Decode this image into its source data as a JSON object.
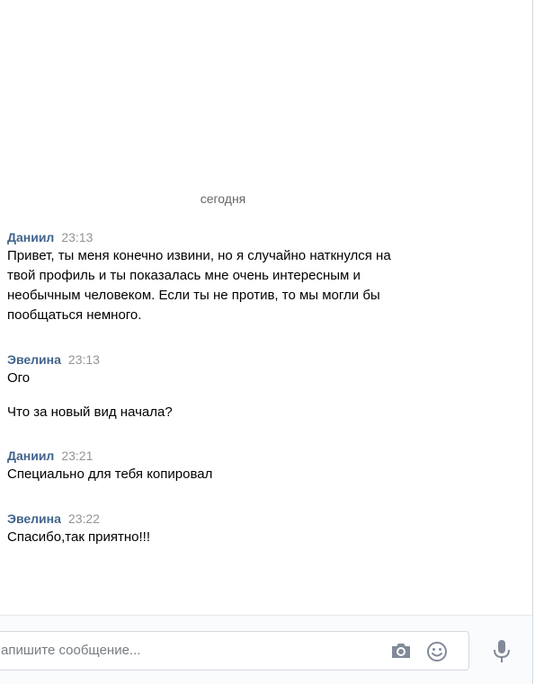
{
  "chat": {
    "date_divider": "сегодня",
    "messages": [
      {
        "author": "Даниил",
        "time": "23:13",
        "lines": [
          "Привет, ты меня конечно извини, но я случайно наткнулся на",
          "твой профиль и ты показалась мне очень интересным и",
          "необычным человеком. Если ты не против, то мы могли бы",
          "пообщаться немного."
        ]
      },
      {
        "author": "Эвелина",
        "time": "23:13",
        "lines": [
          "Ого",
          "Что за новый вид начала?"
        ]
      },
      {
        "author": "Даниил",
        "time": "23:21",
        "lines": [
          "Специально для тебя копировал"
        ]
      },
      {
        "author": "Эвелина",
        "time": "23:22",
        "lines": [
          "Спасибо,так приятно!!!"
        ]
      }
    ]
  },
  "composer": {
    "placeholder": "апишите сообщение...",
    "icons": [
      "camera-icon",
      "smile-icon",
      "microphone-icon"
    ]
  },
  "colors": {
    "author": "#42648b",
    "time": "#939393",
    "icon": "#828a99"
  }
}
